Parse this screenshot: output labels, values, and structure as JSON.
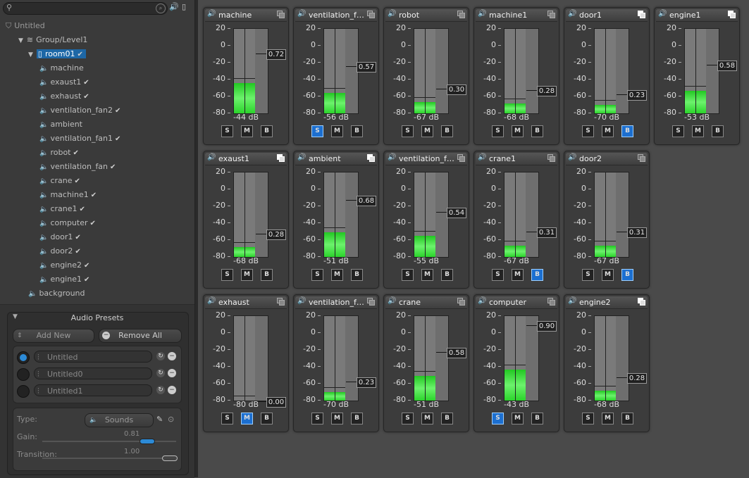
{
  "search": {
    "value": ""
  },
  "tree": {
    "project": "Untitled",
    "group": "Group/Level1",
    "selected": "room01",
    "items": [
      {
        "label": "machine",
        "check": false
      },
      {
        "label": "exaust1",
        "check": true
      },
      {
        "label": "exhaust",
        "check": true
      },
      {
        "label": "ventilation_fan2",
        "check": true
      },
      {
        "label": "ambient",
        "check": false
      },
      {
        "label": "ventilation_fan1",
        "check": true
      },
      {
        "label": "robot",
        "check": true
      },
      {
        "label": "ventilation_fan",
        "check": true
      },
      {
        "label": "crane",
        "check": true
      },
      {
        "label": "machine1",
        "check": true
      },
      {
        "label": "crane1",
        "check": true
      },
      {
        "label": "computer",
        "check": true
      },
      {
        "label": "door1",
        "check": true
      },
      {
        "label": "door2",
        "check": true
      },
      {
        "label": "engine2",
        "check": true
      },
      {
        "label": "engine1",
        "check": true
      }
    ],
    "background": "background",
    "check_glyph": "✔"
  },
  "presets": {
    "title": "Audio Presets",
    "add_new": "Add New",
    "remove_all": "Remove All",
    "list": [
      {
        "name": "Untitled",
        "active": true
      },
      {
        "name": "Untitled0",
        "active": false
      },
      {
        "name": "Untitled1",
        "active": false
      }
    ],
    "type_label": "Type:",
    "type_value": "Sounds",
    "gain_label": "Gain:",
    "gain_value": "0.81",
    "gain": 0.81,
    "transition_label": "Transition:",
    "transition_value": "1.00",
    "transition": 1.0
  },
  "mixer": {
    "scale": [
      "20",
      "0",
      "-20",
      "-40",
      "-60",
      "-80"
    ],
    "s_label": "S",
    "m_label": "M",
    "b_label": "B",
    "channels": [
      {
        "name": "machine",
        "db": "-44 dB",
        "level": -44,
        "fader": "0.72",
        "s": false,
        "m": false,
        "b": false,
        "copy_white": false
      },
      {
        "name": "ventilation_fa...",
        "db": "-56 dB",
        "level": -56,
        "fader": "0.57",
        "s": true,
        "m": false,
        "b": false,
        "copy_white": false
      },
      {
        "name": "robot",
        "db": "-67 dB",
        "level": -67,
        "fader": "0.30",
        "s": false,
        "m": false,
        "b": false,
        "copy_white": false
      },
      {
        "name": "machine1",
        "db": "-68 dB",
        "level": -68,
        "fader": "0.28",
        "s": false,
        "m": false,
        "b": false,
        "copy_white": false
      },
      {
        "name": "door1",
        "db": "-70 dB",
        "level": -70,
        "fader": "0.23",
        "s": false,
        "m": false,
        "b": true,
        "copy_white": true
      },
      {
        "name": "engine1",
        "db": "-53 dB",
        "level": -53,
        "fader": "0.58",
        "s": false,
        "m": false,
        "b": false,
        "copy_white": true
      },
      {
        "name": "exaust1",
        "db": "-68 dB",
        "level": -68,
        "fader": "0.28",
        "s": false,
        "m": false,
        "b": false,
        "copy_white": true
      },
      {
        "name": "ambient",
        "db": "-51 dB",
        "level": -51,
        "fader": "0.68",
        "s": false,
        "m": false,
        "b": false,
        "copy_white": true
      },
      {
        "name": "ventilation_fa...",
        "db": "-55 dB",
        "level": -55,
        "fader": "0.54",
        "s": false,
        "m": false,
        "b": false,
        "copy_white": false
      },
      {
        "name": "crane1",
        "db": "-67 dB",
        "level": -67,
        "fader": "0.31",
        "s": false,
        "m": false,
        "b": true,
        "copy_white": false
      },
      {
        "name": "door2",
        "db": "-67 dB",
        "level": -67,
        "fader": "0.31",
        "s": false,
        "m": false,
        "b": true,
        "copy_white": false
      },
      {
        "name": "exhaust",
        "db": "-80 dB",
        "level": -80,
        "fader": "0.00",
        "s": false,
        "m": true,
        "b": false,
        "copy_white": false
      },
      {
        "name": "ventilation_fa...",
        "db": "-70 dB",
        "level": -70,
        "fader": "0.23",
        "s": false,
        "m": false,
        "b": false,
        "copy_white": false
      },
      {
        "name": "crane",
        "db": "-51 dB",
        "level": -51,
        "fader": "0.58",
        "s": false,
        "m": false,
        "b": false,
        "copy_white": false
      },
      {
        "name": "computer",
        "db": "-43 dB",
        "level": -43,
        "fader": "0.90",
        "s": true,
        "m": false,
        "b": false,
        "copy_white": false
      },
      {
        "name": "engine2",
        "db": "-68 dB",
        "level": -68,
        "fader": "0.28",
        "s": false,
        "m": false,
        "b": false,
        "copy_white": true
      }
    ]
  },
  "colors": {
    "selection": "#1d67a6",
    "meter_green": "#2bd42b",
    "button_on": "#1c6fd0"
  },
  "icons": {
    "search": "search-icon",
    "speaker": "speaker-icon",
    "copy": "copy-icon",
    "lock": "lock-icon"
  }
}
